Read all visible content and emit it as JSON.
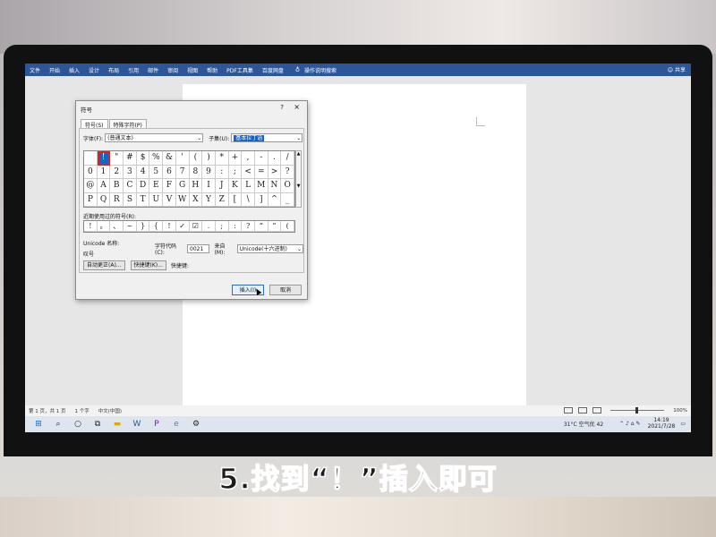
{
  "ribbon": {
    "tabs": [
      "文件",
      "开始",
      "插入",
      "设计",
      "布局",
      "引用",
      "邮件",
      "审阅",
      "视图",
      "帮助",
      "PDF工具集",
      "百度网盘"
    ],
    "tell_me": "操作说明搜索",
    "share": "共享"
  },
  "dialog": {
    "title": "符号",
    "help": "?",
    "close": "×",
    "tabs": [
      "符号(S)",
      "特殊字符(P)"
    ],
    "font_label": "字体(F):",
    "font_value": "(普通文本)",
    "subset_label": "子集(U):",
    "subset_value": "基本拉丁语",
    "symbols": [
      " ",
      "!",
      "\"",
      "#",
      "$",
      "%",
      "&",
      "'",
      "(",
      ")",
      "*",
      "+",
      ",",
      "-",
      ".",
      "/",
      "0",
      "1",
      "2",
      "3",
      "4",
      "5",
      "6",
      "7",
      "8",
      "9",
      ":",
      ";",
      "<",
      "=",
      ">",
      "?",
      "@",
      "A",
      "B",
      "C",
      "D",
      "E",
      "F",
      "G",
      "H",
      "I",
      "J",
      "K",
      "L",
      "M",
      "N",
      "O",
      "P",
      "Q",
      "R",
      "S",
      "T",
      "U",
      "V",
      "W",
      "X",
      "Y",
      "Z",
      "[",
      "\\",
      "]",
      "^",
      "_"
    ],
    "recent_label": "近期使用过的符号(R):",
    "recent": [
      "!",
      "。",
      "、",
      "~",
      "}",
      "{",
      "!",
      "✓",
      "☑",
      ".",
      ";",
      ":",
      "?",
      "“",
      "”",
      "("
    ],
    "unicode_name_label": "Unicode 名称:",
    "unicode_name_value": "叹号",
    "code_label": "字符代码(C):",
    "code_value": "0021",
    "from_label": "来自(M):",
    "from_value": "Unicode(十六进制)",
    "autocorrect_button": "自动更正(A)...",
    "shortcut_button": "快捷键(K)...",
    "shortcut_label": "快捷键:",
    "insert_button": "插入(I)",
    "cancel_button": "取消"
  },
  "statusbar": {
    "page": "第 1 页，共 1 页",
    "words": "1 个字",
    "language": "中文(中国)",
    "zoom": "100%"
  },
  "taskbar": {
    "weather": "31°C 空气优 42",
    "time": "14:19",
    "date": "2021/7/28"
  },
  "caption": "5.找到“！”插入即可"
}
